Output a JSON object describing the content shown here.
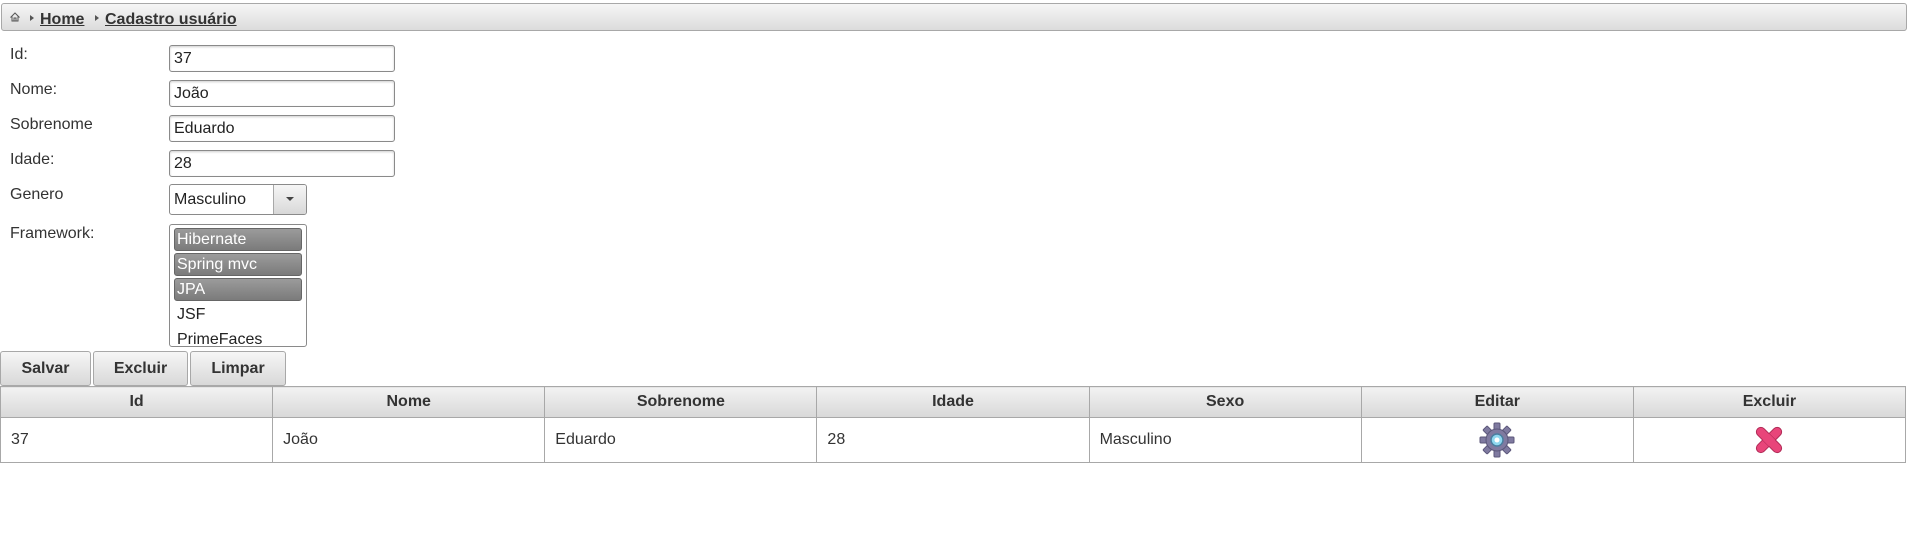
{
  "breadcrumb": {
    "items": [
      {
        "label": "Home"
      },
      {
        "label": "Cadastro usuário"
      }
    ]
  },
  "form": {
    "id": {
      "label": "Id:",
      "value": "37"
    },
    "nome": {
      "label": "Nome:",
      "value": "João"
    },
    "sobrenome": {
      "label": "Sobrenome",
      "value": "Eduardo"
    },
    "idade": {
      "label": "Idade:",
      "value": "28"
    },
    "genero": {
      "label": "Genero",
      "selected": "Masculino"
    },
    "framework": {
      "label": "Framework:",
      "options": [
        {
          "label": "Hibernate",
          "selected": true
        },
        {
          "label": "Spring mvc",
          "selected": true
        },
        {
          "label": "JPA",
          "selected": true
        },
        {
          "label": "JSF",
          "selected": false
        },
        {
          "label": "PrimeFaces",
          "selected": false
        }
      ]
    }
  },
  "buttons": {
    "salvar": "Salvar",
    "excluir": "Excluir",
    "limpar": "Limpar"
  },
  "table": {
    "columns": [
      "Id",
      "Nome",
      "Sobrenome",
      "Idade",
      "Sexo",
      "Editar",
      "Excluir"
    ],
    "rows": [
      {
        "id": "37",
        "nome": "João",
        "sobrenome": "Eduardo",
        "idade": "28",
        "sexo": "Masculino",
        "edit_icon": "gear-icon",
        "delete_icon": "close-icon"
      }
    ]
  },
  "colors": {
    "header_border": "#a8a8a8",
    "selected_option": "#8a8a8a",
    "gear": "#7f7aa0",
    "delete": "#e8457a"
  }
}
